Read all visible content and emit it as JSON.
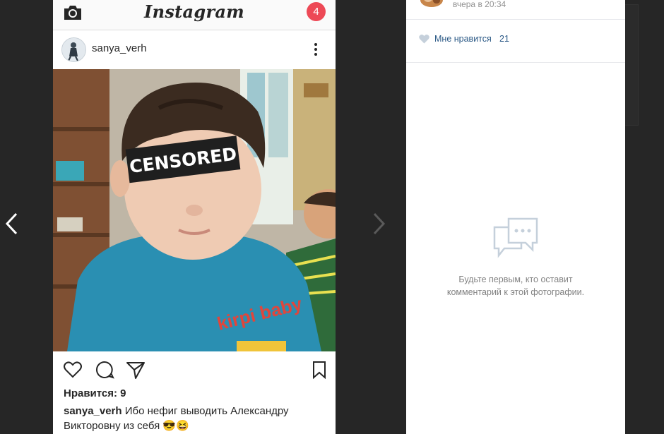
{
  "viewer": {
    "prev_icon": "chevron-left-icon",
    "next_icon": "chevron-right-icon"
  },
  "instagram": {
    "logo": "Instagram",
    "camera_icon": "camera-icon",
    "notification_count": "4",
    "post": {
      "username": "sanya_verh",
      "more_icon": "more-vertical-icon",
      "photo_label": "CENSORED",
      "shirt_text": "kirpi baby",
      "actions": [
        "heart-icon",
        "comment-icon",
        "share-icon",
        "bookmark-icon"
      ],
      "likes": "Нравится: 9",
      "caption_user": "sanya_verh",
      "caption_text": " Ибо нефиг выводить Александру Викторовну из себя 😎😆"
    }
  },
  "vk": {
    "post_time": "вчера в 20:34",
    "like_label": "Мне нравится",
    "like_count": "21",
    "empty_comments_line1": "Будьте первым, кто оставит",
    "empty_comments_line2": "комментарий к этой фотографии.",
    "colors": {
      "link": "#2a5885",
      "muted": "#828282"
    }
  }
}
